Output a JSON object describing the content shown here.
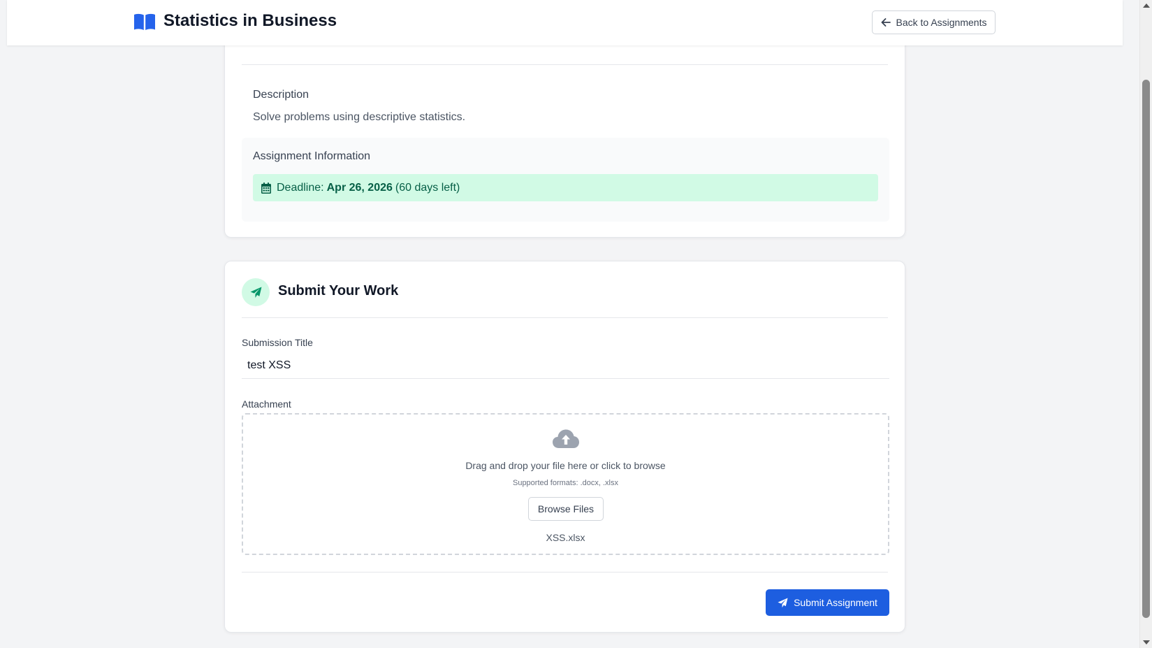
{
  "header": {
    "title": "Statistics in Business",
    "back_label": "Back to Assignments"
  },
  "details": {
    "description_label": "Description",
    "description_text": "Solve problems using descriptive statistics.",
    "info_label": "Assignment Information",
    "deadline_prefix": "Deadline:",
    "deadline_date": "Apr 26, 2026",
    "deadline_remaining": "(60 days left)"
  },
  "submission": {
    "heading": "Submit Your Work",
    "title_label": "Submission Title",
    "title_value": "test XSS",
    "attachment_label": "Attachment",
    "drop_text": "Drag and drop your file here or click to browse",
    "formats_text": "Supported formats: .docx, .xlsx",
    "browse_label": "Browse Files",
    "file_name": "XSS.xlsx",
    "submit_label": "Submit Assignment"
  },
  "colors": {
    "accent_blue": "#1d5ee0",
    "deadline_bg": "#d1fae5",
    "deadline_text": "#065f46",
    "icon_green": "#059669"
  },
  "icons": {
    "logo": "open-book-icon",
    "back": "arrow-left-icon",
    "calendar": "calendar-icon",
    "send": "paper-plane-icon",
    "upload": "cloud-upload-icon"
  }
}
